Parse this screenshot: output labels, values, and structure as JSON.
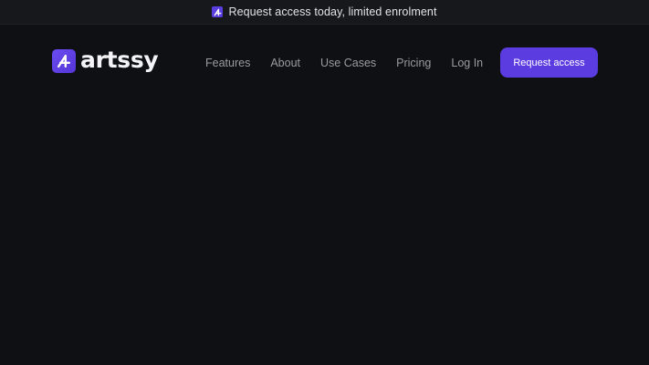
{
  "announcement": {
    "text": "Request access today, limited enrolment",
    "icon": "artssy-logo-icon"
  },
  "brand": {
    "name": "artssy",
    "icon": "artssy-logo-icon",
    "accent_color": "#5a3ce0"
  },
  "nav": {
    "items": [
      {
        "label": "Features"
      },
      {
        "label": "About"
      },
      {
        "label": "Use Cases"
      },
      {
        "label": "Pricing"
      },
      {
        "label": "Log In"
      }
    ]
  },
  "cta": {
    "label": "Request access"
  }
}
